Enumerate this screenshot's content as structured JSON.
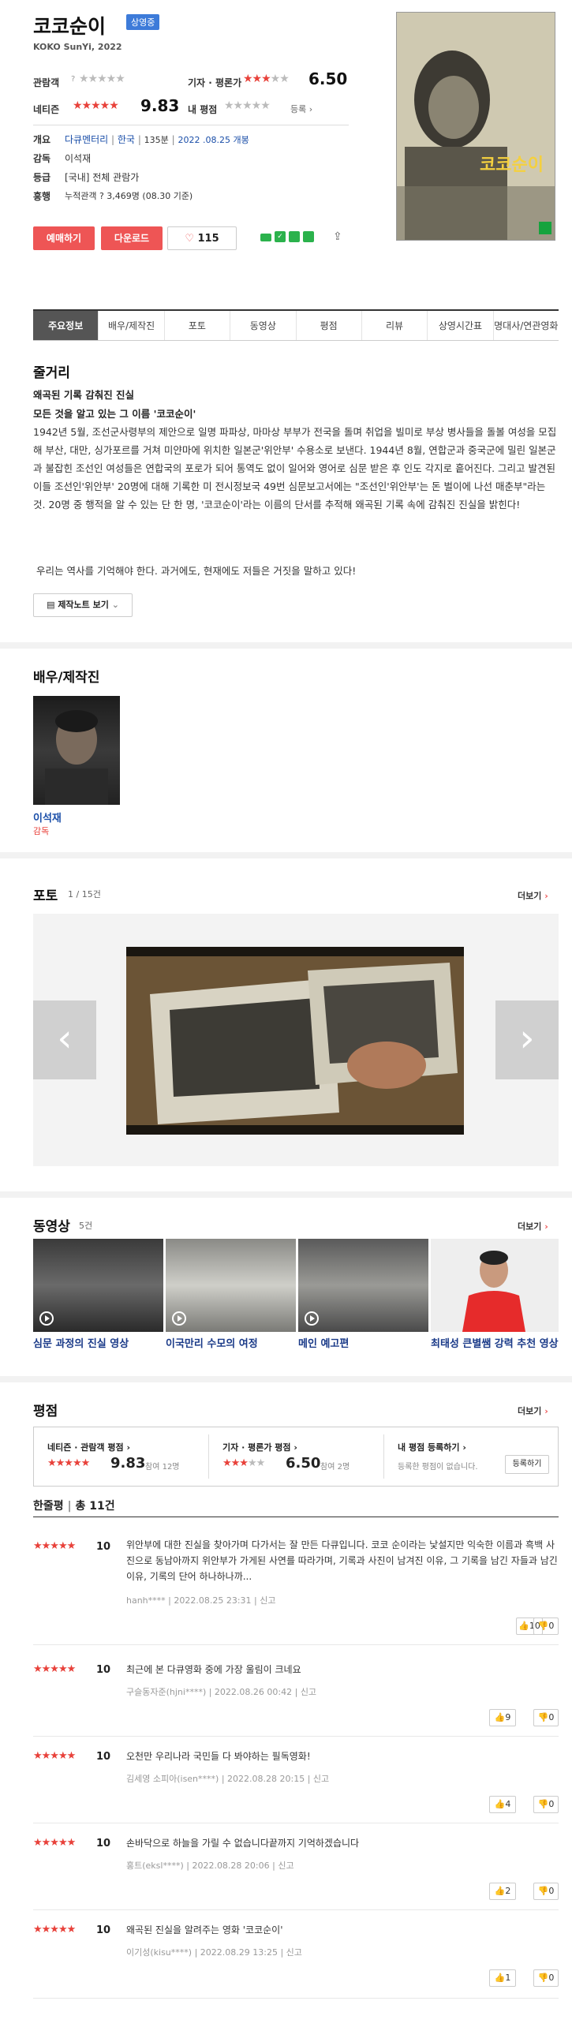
{
  "movie": {
    "title": "코코순이",
    "status_badge": "상영중",
    "subtitle": "KOKO SunYi, 2022"
  },
  "ratings": {
    "audience_label": "관람객",
    "critic_label": "기자 · 평론가",
    "critic_score": "6.50",
    "netizen_label": "네티즌",
    "netizen_score": "9.83",
    "my_label": "내 평점",
    "register_label": "등록"
  },
  "info": {
    "overview_label": "개요",
    "genre": "다큐멘터리",
    "country": "한국",
    "runtime": "135분",
    "release": "2022 .08.25 개봉",
    "director_label": "감독",
    "director": "이석재",
    "grade_label": "등급",
    "grade": "[국내] 전체 관람가",
    "box_label": "흥행",
    "box_value": "누적관객 ?  3,469명 (08.30 기준)"
  },
  "actions": {
    "reserve": "예매하기",
    "download": "다운로드",
    "likes": "115"
  },
  "tabs": [
    "주요정보",
    "배우/제작진",
    "포토",
    "동영상",
    "평점",
    "리뷰",
    "상영시간표",
    "명대사/연관영화"
  ],
  "synopsis": {
    "heading": "줄거리",
    "tagline1": "왜곡된 기록 감춰진 진실",
    "tagline2": "모든 것을 알고 있는 그 이름 '코코순이'",
    "body": "1942년 5월, 조선군사령부의 제안으로 일명 파파상, 마마상 부부가 전국을 돌며 취업을 빌미로 부상 병사들을 돌볼 여성을 모집해 부산, 대만, 싱가포르를 거쳐 미얀마에 위치한 일본군'위안부' 수용소로 보낸다. 1944년 8월, 연합군과 중국군에 밀린 일본군과 불잡힌 조선인 여성들은 연합국의 포로가 되어 통역도 없이 일어와 영어로 심문 받은 후 인도 각지로 흩어진다. 그리고 발견된 이들 조선인'위안부' 20명에 대해 기록한 미 전시정보국 49번 심문보고서에는 \"조선인'위안부'는 돈 벌이에 나선 매춘부\"라는 것. 20명 중 행적을 알 수 있는 단 한 명, '코코순이'라는 이름의 단서를 추적해 왜곡된 기록 속에 감춰진 진실을 밝힌다!",
    "closing": "우리는 역사를 기억해야 한다. 과거에도, 현재에도 저들은 거짓을 말하고 있다!",
    "notes_button": "제작노트 보기"
  },
  "cast": {
    "heading": "배우/제작진",
    "name": "이석재",
    "role": "감독"
  },
  "photo": {
    "heading": "포토",
    "counter": "1 / 15건",
    "more": "더보기"
  },
  "video": {
    "heading": "동영상",
    "count": "5건",
    "more": "더보기",
    "items": [
      "심문 과정의 진실 영상",
      "이국만리 수모의 여정",
      "메인 예고편",
      "최태성 큰별쌤 강력 추천 영상"
    ]
  },
  "rating_section": {
    "heading": "평점",
    "more": "더보기",
    "netizen_box_label": "네티즌 · 관람객 평점",
    "netizen_box_score": "9.83",
    "netizen_box_count": "참여 12명",
    "critic_box_label": "기자 · 평론가 평점",
    "critic_box_score": "6.50",
    "critic_box_count": "참여 2명",
    "my_box_label": "내 평점 등록하기",
    "my_box_text": "등록한 평점이 없습니다.",
    "register_button": "등록하기",
    "short_review_label": "한줄평",
    "short_review_total": "총 11건"
  },
  "reviews": [
    {
      "score": "10",
      "text": "위안부에 대한 진실을 찾아가며 다가서는 잘 만든 다큐입니다. 코코 순이라는 낯설지만 익숙한 이름과 흑백 사진으로 동남아까지 위안부가 가게된 사연를 따라가며, 기록과 사진이 남겨진 이유, 그 기록을 남긴 자들과 남긴 이유, 기록의 단어 하나하나까...",
      "meta": "hanh****  |  2022.08.25 23:31  |  신고",
      "up": "10",
      "down": "0"
    },
    {
      "score": "10",
      "text": "최근에 본 다큐영화 중에 가장 울림이 크네요",
      "meta": "구슬동자준(hjni****)  |  2022.08.26 00:42  |  신고",
      "up": "9",
      "down": "0"
    },
    {
      "score": "10",
      "text": "오천만 우리나라 국민들 다 봐야하는 필독영화!",
      "meta": "김세영 소피아(isen****)  |  2022.08.28 20:15  |  신고",
      "up": "4",
      "down": "0"
    },
    {
      "score": "10",
      "text": "손바닥으로 하늘을 가릴 수 없습니다끝까지 기억하겠습니다",
      "meta": "홍트(eksl****)  |  2022.08.28 20:06  |  신고",
      "up": "2",
      "down": "0"
    },
    {
      "score": "10",
      "text": "왜곡된 진실을 알려주는 영화 '코코순이'",
      "meta": "이기성(kisu****)  |  2022.08.29 13:25  |  신고",
      "up": "1",
      "down": "0"
    }
  ],
  "colors": {
    "accent": "#e8413a",
    "link": "#1a4ea8",
    "badge": "#3d7bd9"
  }
}
